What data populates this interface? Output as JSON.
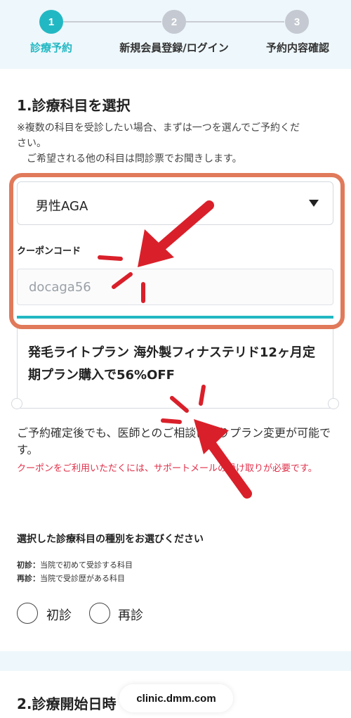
{
  "steps": [
    {
      "number": "1",
      "label": "診療予約"
    },
    {
      "number": "2",
      "label": "新規会員登録/ログイン"
    },
    {
      "number": "3",
      "label": "予約内容確認"
    }
  ],
  "colors": {
    "active_step": "#22b8c3",
    "inactive_step": "#c5c9d1",
    "highlight_border": "#e07a5a",
    "arrow": "#d9202a",
    "warning_text": "#e0304a"
  },
  "section1": {
    "title": "1.診療科目を選択",
    "note_line1": "※複数の科目を受診したい場合、まずは一つを選んでご予約くだ",
    "note_line2": "さい。",
    "note_line3": "　ご希望される他の科目は問診票でお聞きします。",
    "select_value": "男性AGA",
    "coupon_label": "クーポンコード",
    "coupon_value": "docaga56",
    "coupon_text": "発毛ライトプラン 海外製フィナステリド12ヶ月定期プラン購入で56%OFF",
    "plan_note": "ご予約確定後でも、医師とのご相談によりプラン変更が可能です。",
    "warning_note": "クーポンをご利用いただくには、サポートメールの受け取りが必要です。"
  },
  "kind": {
    "title": "選択した診療科目の種別をお選びください",
    "first_visit_term": "初診：",
    "first_visit_def": "当院で初めて受診する科目",
    "return_visit_term": "再診：",
    "return_visit_def": "当院で受診歴がある科目",
    "option_first": "初診",
    "option_return": "再診"
  },
  "section2": {
    "title": "2.診療開始日時"
  },
  "browser": {
    "url": "clinic.dmm.com"
  }
}
